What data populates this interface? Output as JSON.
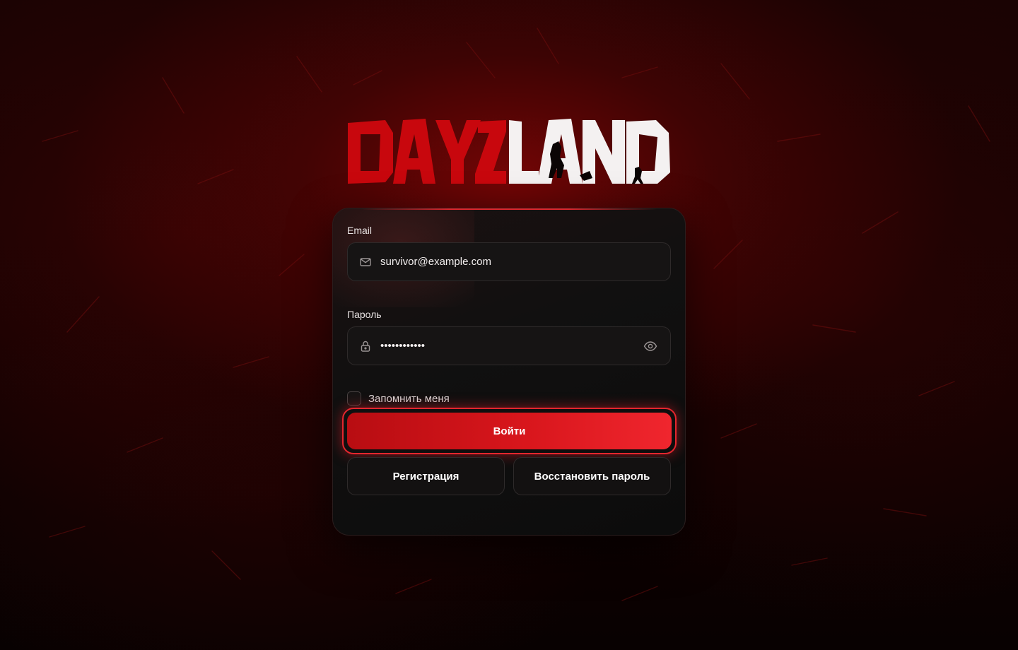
{
  "brand": {
    "name_part1": "DAYZ",
    "name_part2": "LAND"
  },
  "form": {
    "email": {
      "label": "Email",
      "value": "survivor@example.com",
      "icon": "mail-icon"
    },
    "password": {
      "label": "Пароль",
      "value": "••••••••••••",
      "icon": "lock-icon",
      "toggle_icon": "eye-icon"
    },
    "remember": {
      "label": "Запомнить меня",
      "checked": false
    },
    "login_label": "Войти",
    "register_label": "Регистрация",
    "recover_label": "Восстановить пароль"
  },
  "colors": {
    "accent": "#e3262e",
    "accent_dark": "#b80d12",
    "background": "#150202",
    "card": "#111010"
  }
}
